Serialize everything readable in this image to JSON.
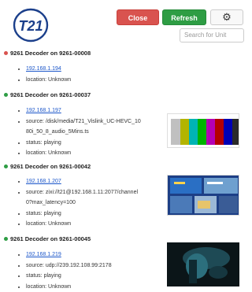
{
  "header": {
    "logo_text": "T21",
    "close_label": "Close",
    "refresh_label": "Refresh",
    "settings_icon": "gear-icon",
    "search_placeholder": "Search for Unit"
  },
  "colors": {
    "close": "#d9534f",
    "refresh": "#2e9d44",
    "status_offline": "#d9534f",
    "status_online": "#2e9d44",
    "link": "#1a55c9"
  },
  "units": [
    {
      "title": "9261 Decoder on 9261-00008",
      "status_color": "red",
      "ip": "192.168.1.194",
      "location": "location: Unknown"
    },
    {
      "title": "9261 Decoder on 9261-00037",
      "status_color": "green",
      "ip": "192.168.1.197",
      "source_line1": "source: /disk/media/T21_Vislink_UC-HEVC_10",
      "source_line2": "80i_50_8_audio_5Mins.ts",
      "status": "status: playing",
      "location": "location: Unknown"
    },
    {
      "title": "9261 Decoder on 9261-00042",
      "status_color": "green",
      "ip": "192.168.1.207",
      "source_line1": "source: zixi://t21@192.168.1.11:2077/channel",
      "source_line2": "0?max_latency=100",
      "status": "status: playing",
      "location": "location: Unknown"
    },
    {
      "title": "9261 Decoder on 9261-00045",
      "status_color": "green",
      "ip": "192.168.1.219",
      "source_line1": "source: udp://239.192.108.99:2178",
      "status": "status: playing",
      "location": "location: Unknown"
    }
  ]
}
